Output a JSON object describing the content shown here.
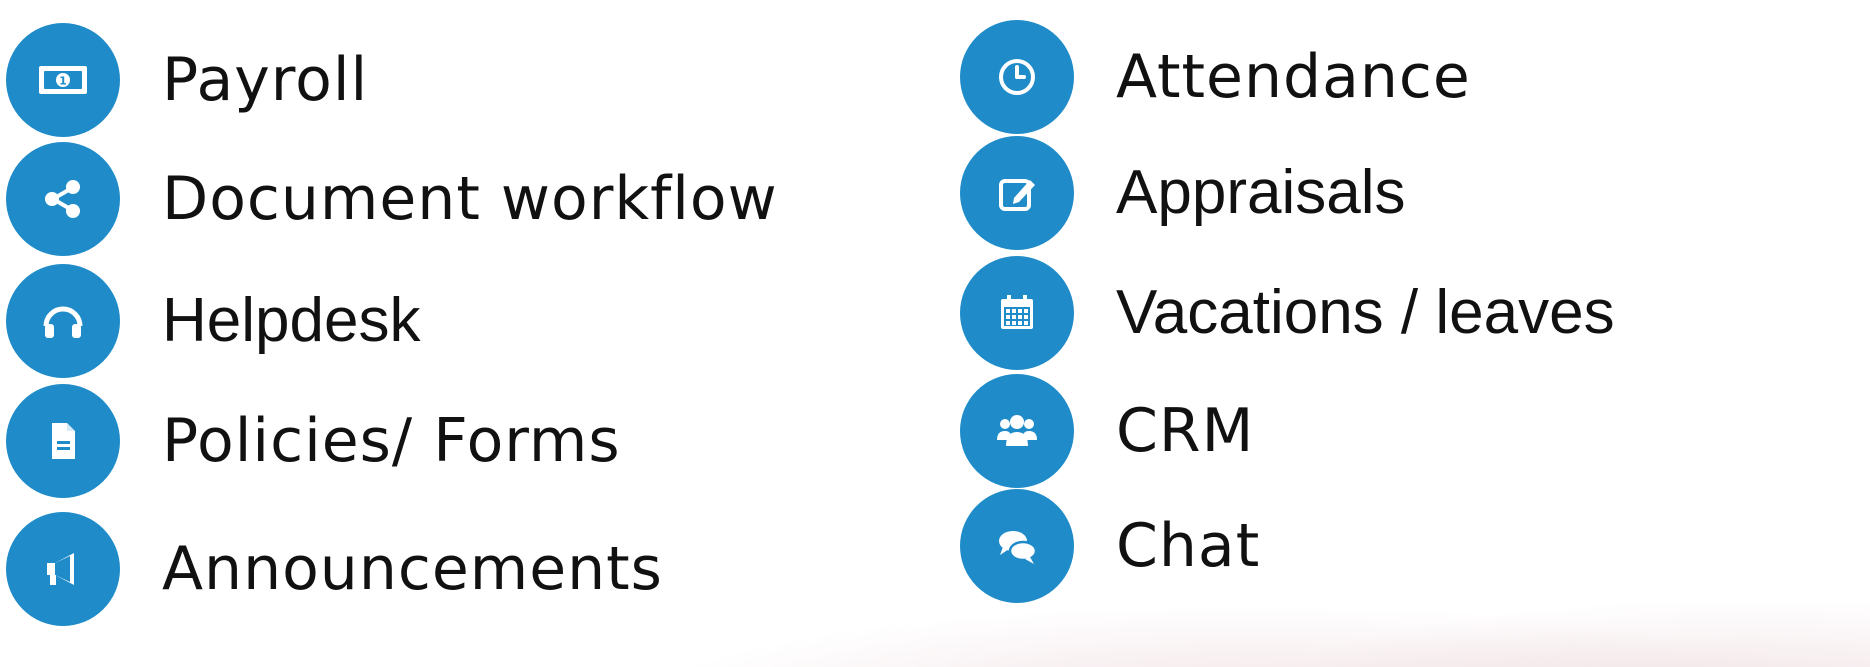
{
  "features_left": [
    {
      "label": "Payroll",
      "icon": "money-bill-icon"
    },
    {
      "label": "Document workflow",
      "icon": "share-icon"
    },
    {
      "label": "Helpdesk",
      "icon": "headphones-icon"
    },
    {
      "label": "Policies/ Forms",
      "icon": "file-icon"
    },
    {
      "label": "Announcements",
      "icon": "megaphone-icon"
    }
  ],
  "features_right": [
    {
      "label": "Attendance",
      "icon": "clock-icon"
    },
    {
      "label": "Appraisals",
      "icon": "edit-icon"
    },
    {
      "label": "Vacations / leaves",
      "icon": "calendar-icon"
    },
    {
      "label": "CRM",
      "icon": "users-icon"
    },
    {
      "label": "Chat",
      "icon": "chat-icon"
    }
  ],
  "colors": {
    "icon_background": "#1f8cc9",
    "text": "#111111"
  }
}
